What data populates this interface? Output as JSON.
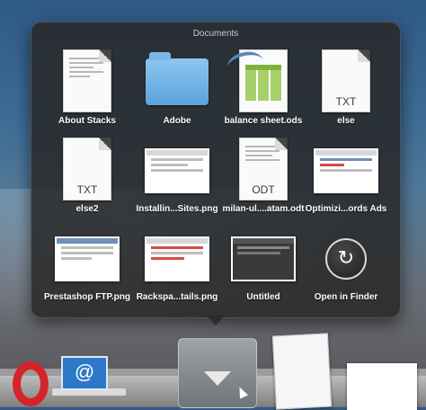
{
  "stack": {
    "title": "Documents",
    "items": [
      {
        "label": "About Stacks",
        "icon": "document-preview-icon"
      },
      {
        "label": "Adobe",
        "icon": "folder-icon"
      },
      {
        "label": "balance sheet.ods",
        "icon": "spreadsheet-icon"
      },
      {
        "label": "else",
        "icon": "txt-file-icon",
        "ext": "TXT"
      },
      {
        "label": "else2",
        "icon": "txt-file-icon",
        "ext": "TXT"
      },
      {
        "label": "Installin...Sites.png",
        "icon": "png-preview-icon"
      },
      {
        "label": "milan-ul....atam.odt",
        "icon": "odt-file-icon",
        "ext": "ODT"
      },
      {
        "label": "Optimizi...ords Ads",
        "icon": "png-preview-icon"
      },
      {
        "label": "Prestashop FTP.png",
        "icon": "png-preview-icon"
      },
      {
        "label": "Rackspa...tails.png",
        "icon": "png-preview-icon"
      },
      {
        "label": "Untitled",
        "icon": "png-preview-icon"
      },
      {
        "label": "Open in Finder",
        "icon": "open-in-finder-icon"
      }
    ]
  },
  "dock": {
    "items": [
      "opera-icon",
      "mail-icon",
      "stack-toggle-icon",
      "document-stack-icon",
      "screenshot-icon"
    ]
  },
  "finder_glyph": "↻"
}
